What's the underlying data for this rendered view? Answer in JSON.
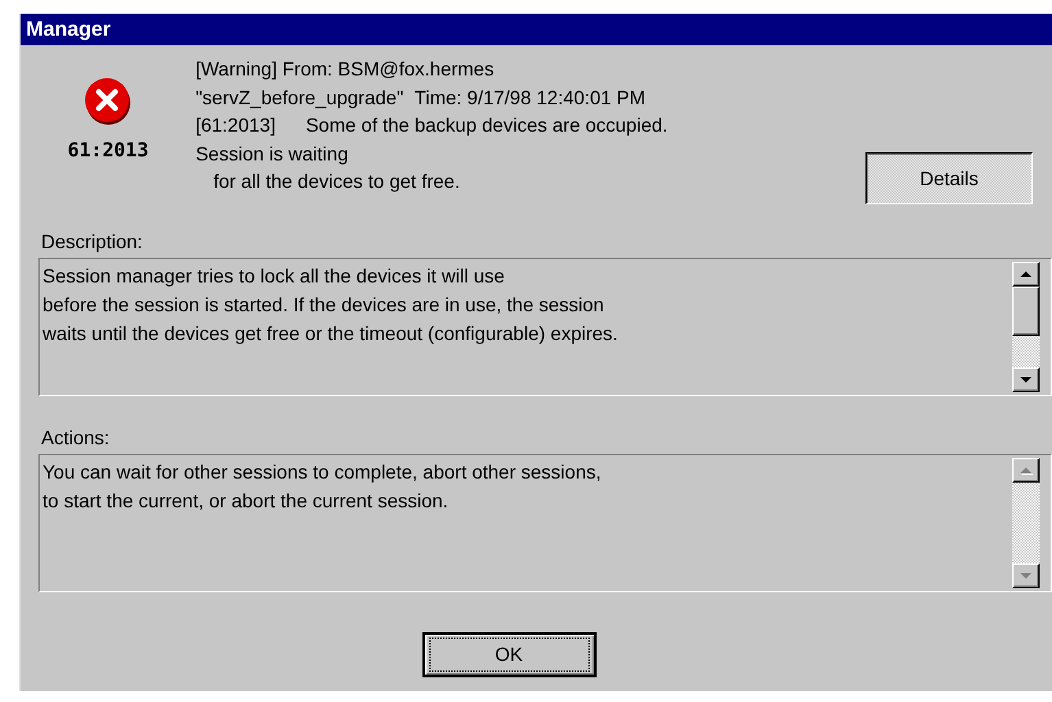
{
  "window": {
    "title": "Manager"
  },
  "alert": {
    "icon": {
      "kind": "error"
    },
    "code": "61:2013"
  },
  "message": {
    "header": "[Warning] From: BSM@fox.hermes",
    "session": "\"servZ_before_upgrade\"",
    "time": "Time: 9/17/98 12:40:01 PM",
    "code": "[61:2013]",
    "text": "Some of the backup devices are occupied.",
    "status": "Session is waiting",
    "status_detail": "for all the devices to get free."
  },
  "details_button": {
    "label": "Details"
  },
  "description": {
    "label": "Description:",
    "lines": [
      "Session manager tries to lock all the devices it will use",
      "before the session is started. If the devices are in use, the session",
      "waits until the devices get free or the timeout (configurable) expires."
    ],
    "scrollbar": {
      "disabled": false
    }
  },
  "actions": {
    "label": "Actions:",
    "lines": [
      "You can wait for other sessions to complete, abort other sessions,",
      "to start the current, or abort the current session."
    ],
    "scrollbar": {
      "disabled": true
    }
  },
  "ok_button": {
    "label": "OK",
    "focused": true
  }
}
